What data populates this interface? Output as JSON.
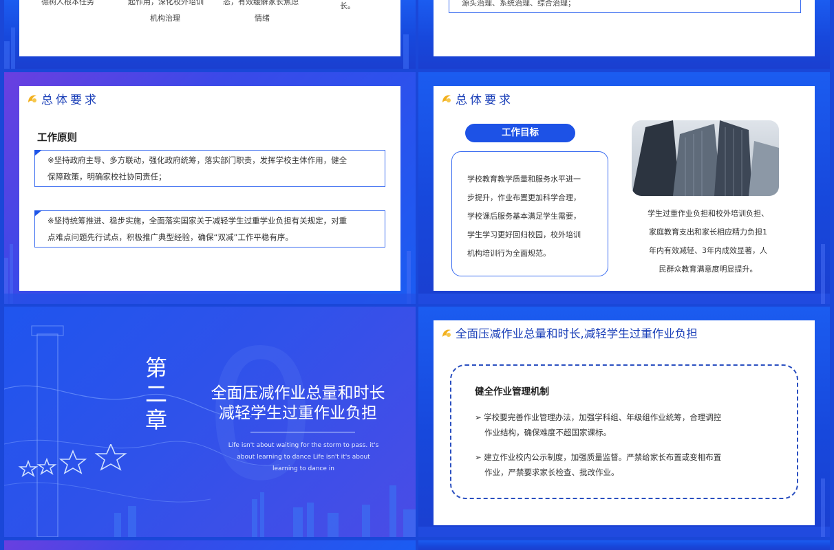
{
  "top_left": {
    "fragments": [
      "德树人根本任务",
      "起作用，深化校外培训",
      "机构治理",
      "态，有效缓解家长焦虑",
      "情绪",
      "长。"
    ]
  },
  "top_right": {
    "line": "源头治理、系统治理、综合治理；"
  },
  "slide_a": {
    "title": "总体要求",
    "subtitle": "工作原则",
    "box1": [
      "※坚持政府主导、多方联动，强化政府统筹，落实部门职责，发挥学校主体作用，健全",
      "保障政策，明确家校社协同责任；"
    ],
    "box2": [
      "※坚持统筹推进、稳步实施，全面落实国家关于减轻学生过重学业负担有关规定，对重",
      "点难点问题先行试点，积极推广典型经验，确保“双减”工作平稳有序。"
    ]
  },
  "slide_b": {
    "title": "总体要求",
    "pill": "工作目标",
    "box_lines": [
      "学校教育教学质量和服务水平进一",
      "步提升，作业布置更加科学合理，",
      "学校课后服务基本满足学生需要，",
      "学生学习更好回归校园，校外培训",
      "机构培训行为全面规范。"
    ],
    "right_lines": [
      "学生过重作业负担和校外培训负担、",
      "家庭教育支出和家长相应精力负担1",
      "年内有效减轻、3年内成效显著，人",
      "民群众教育满意度明显提升。"
    ]
  },
  "slide_c": {
    "chapter": [
      "第",
      "二",
      "章"
    ],
    "big_number": "0",
    "title_lines": [
      "全面压减作业总量和时长",
      "减轻学生过重作业负担"
    ],
    "english": [
      "Life isn't about waiting for the storm to pass. it's",
      "about learning to dance Life isn't it's about",
      "learning to dance in"
    ]
  },
  "slide_d": {
    "title": "全面压减作业总量和时长,减轻学生过重作业负担",
    "heading": "健全作业管理机制",
    "bullets": [
      [
        "学校要完善作业管理办法，加强学科组、年级组作业统筹，合理调控",
        "作业结构，确保难度不超国家课标。"
      ],
      [
        "建立作业校内公示制度，加强质量监督。严禁给家长布置或变相布置",
        "作业，严禁要求家长检查、批改作业。"
      ]
    ],
    "bullet_glyph": "➢"
  },
  "colors": {
    "accent": "#1d52e6",
    "title": "#1a3fb8",
    "logo": "#f2b01e"
  },
  "icons": [
    "logo-icon",
    "skyscraper-image",
    "huabiao-pillar",
    "star-icon"
  ]
}
